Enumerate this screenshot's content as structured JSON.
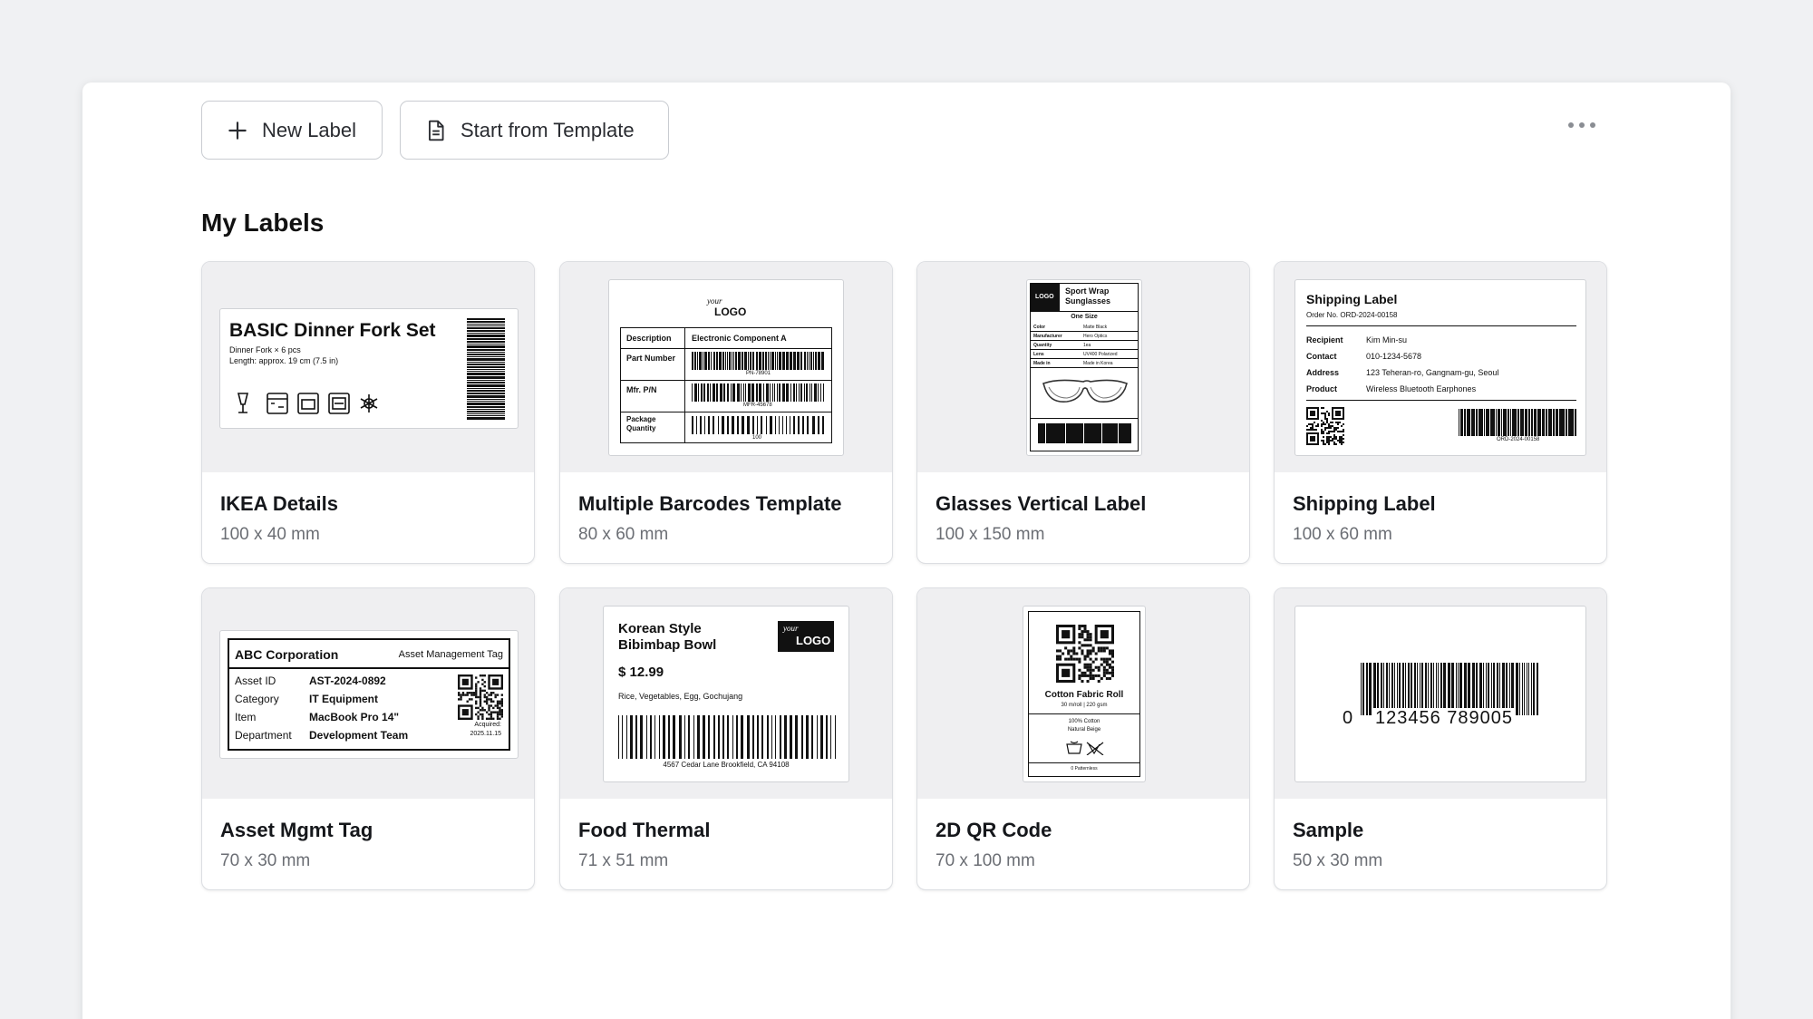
{
  "toolbar": {
    "new_label": "New Label",
    "start_from_template": "Start from Template"
  },
  "section_title": "My Labels",
  "cards": [
    {
      "name": "IKEA Details",
      "size": "100 x 40 mm",
      "preview": {
        "title": "BASIC Dinner Fork Set",
        "line1": "Dinner Fork × 6 pcs",
        "line2": "Length: approx. 19 cm (7.5 in)"
      }
    },
    {
      "name": "Multiple Barcodes Template",
      "size": "80 x 60 mm",
      "preview": {
        "logo_small": "your",
        "logo_big": "LOGO",
        "desc_label": "Description",
        "desc_value": "Electronic Component A",
        "part_label": "Part Number",
        "part_code": "PN-78901",
        "mfr_label": "Mfr. P/N",
        "mfr_code": "MFR-45678",
        "pkg_label": "Package Quantity",
        "pkg_code": "100"
      }
    },
    {
      "name": "Glasses Vertical Label",
      "size": "100 x 150 mm",
      "preview": {
        "logo": "LOGO",
        "title": "Sport Wrap Sunglasses",
        "subtitle": "One Size",
        "rows": [
          [
            "Color",
            "Matte Black"
          ],
          [
            "Manufacturer",
            "Hero Optics"
          ],
          [
            "Quantity",
            "1ea"
          ],
          [
            "Lens",
            "UV400 Polarized"
          ],
          [
            "Made in",
            "Made in Korea"
          ]
        ]
      }
    },
    {
      "name": "Shipping Label",
      "size": "100 x 60 mm",
      "preview": {
        "title": "Shipping Label",
        "order": "Order No. ORD-2024-00158",
        "rows": [
          [
            "Recipient",
            "Kim Min-su"
          ],
          [
            "Contact",
            "010-1234-5678"
          ],
          [
            "Address",
            "123 Teheran-ro, Gangnam-gu, Seoul"
          ],
          [
            "Product",
            "Wireless Bluetooth Earphones"
          ]
        ],
        "code": "ORD-2024-00158"
      }
    },
    {
      "name": "Asset Mgmt Tag",
      "size": "70 x 30 mm",
      "preview": {
        "company": "ABC Corporation",
        "tag": "Asset Management Tag",
        "rows": [
          [
            "Asset ID",
            "AST-2024-0892"
          ],
          [
            "Category",
            "IT Equipment"
          ],
          [
            "Item",
            "MacBook Pro 14\""
          ],
          [
            "Department",
            "Development Team"
          ]
        ],
        "acquired_label": "Acquired:",
        "acquired_date": "2025.11.15"
      }
    },
    {
      "name": "Food Thermal",
      "size": "71 x 51 mm",
      "preview": {
        "title1": "Korean Style",
        "title2": "Bibimbap Bowl",
        "logo_small": "your",
        "logo_big": "LOGO",
        "price": "$ 12.99",
        "ingredients": "Rice, Vegetables, Egg, Gochujang",
        "address": "4567 Cedar Lane Brookfield, CA 94108"
      }
    },
    {
      "name": "2D QR Code",
      "size": "70 x 100 mm",
      "preview": {
        "title": "Cotton Fabric Roll",
        "spec": "30 m/roll | 220 gsm",
        "material1": "100% Cotton",
        "material2": "Natural Beige",
        "footer": "0 Patternless"
      }
    },
    {
      "name": "Sample",
      "size": "50 x 30 mm",
      "preview": {
        "digit_first": "0",
        "digits": "123456 789005"
      }
    }
  ],
  "icons": [
    "plus-icon",
    "document-icon",
    "more-icon"
  ]
}
